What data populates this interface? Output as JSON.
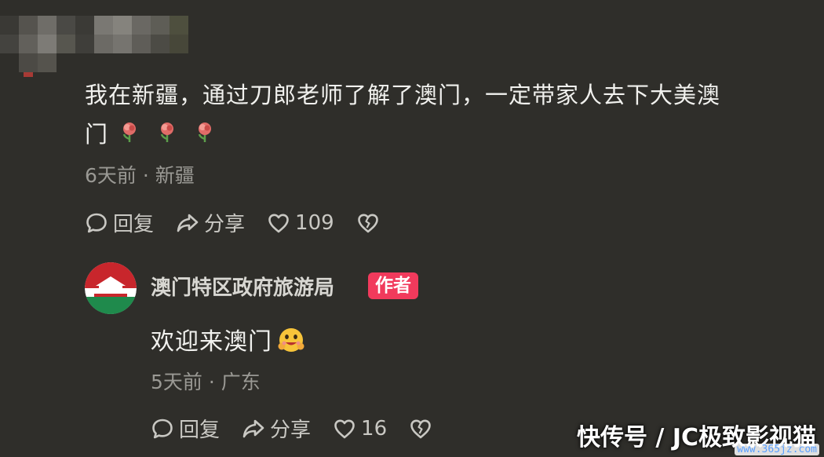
{
  "comment": {
    "text_line1": "我在新疆，通过刀郎老师了解了澳门，一定带家人去下大美澳",
    "text_line2": "门",
    "flower_icons": [
      "rose-icon",
      "rose-icon",
      "rose-icon"
    ],
    "meta": "6天前 · 新疆",
    "actions": {
      "reply_label": "回复",
      "share_label": "分享",
      "like_count": "109"
    }
  },
  "reply": {
    "author_name": "澳门特区政府旅游局",
    "author_badge": "作者",
    "text": "欢迎来澳门",
    "meta": "5天前 · 广东",
    "actions": {
      "reply_label": "回复",
      "share_label": "分享",
      "like_count": "16"
    }
  },
  "watermark": {
    "text": "快传号 / JC极致影视猫",
    "url": "www.365jz.com"
  },
  "colors": {
    "background": "#2f2e2a",
    "badge": "#f13a5c",
    "meta_text": "#9a9994"
  }
}
